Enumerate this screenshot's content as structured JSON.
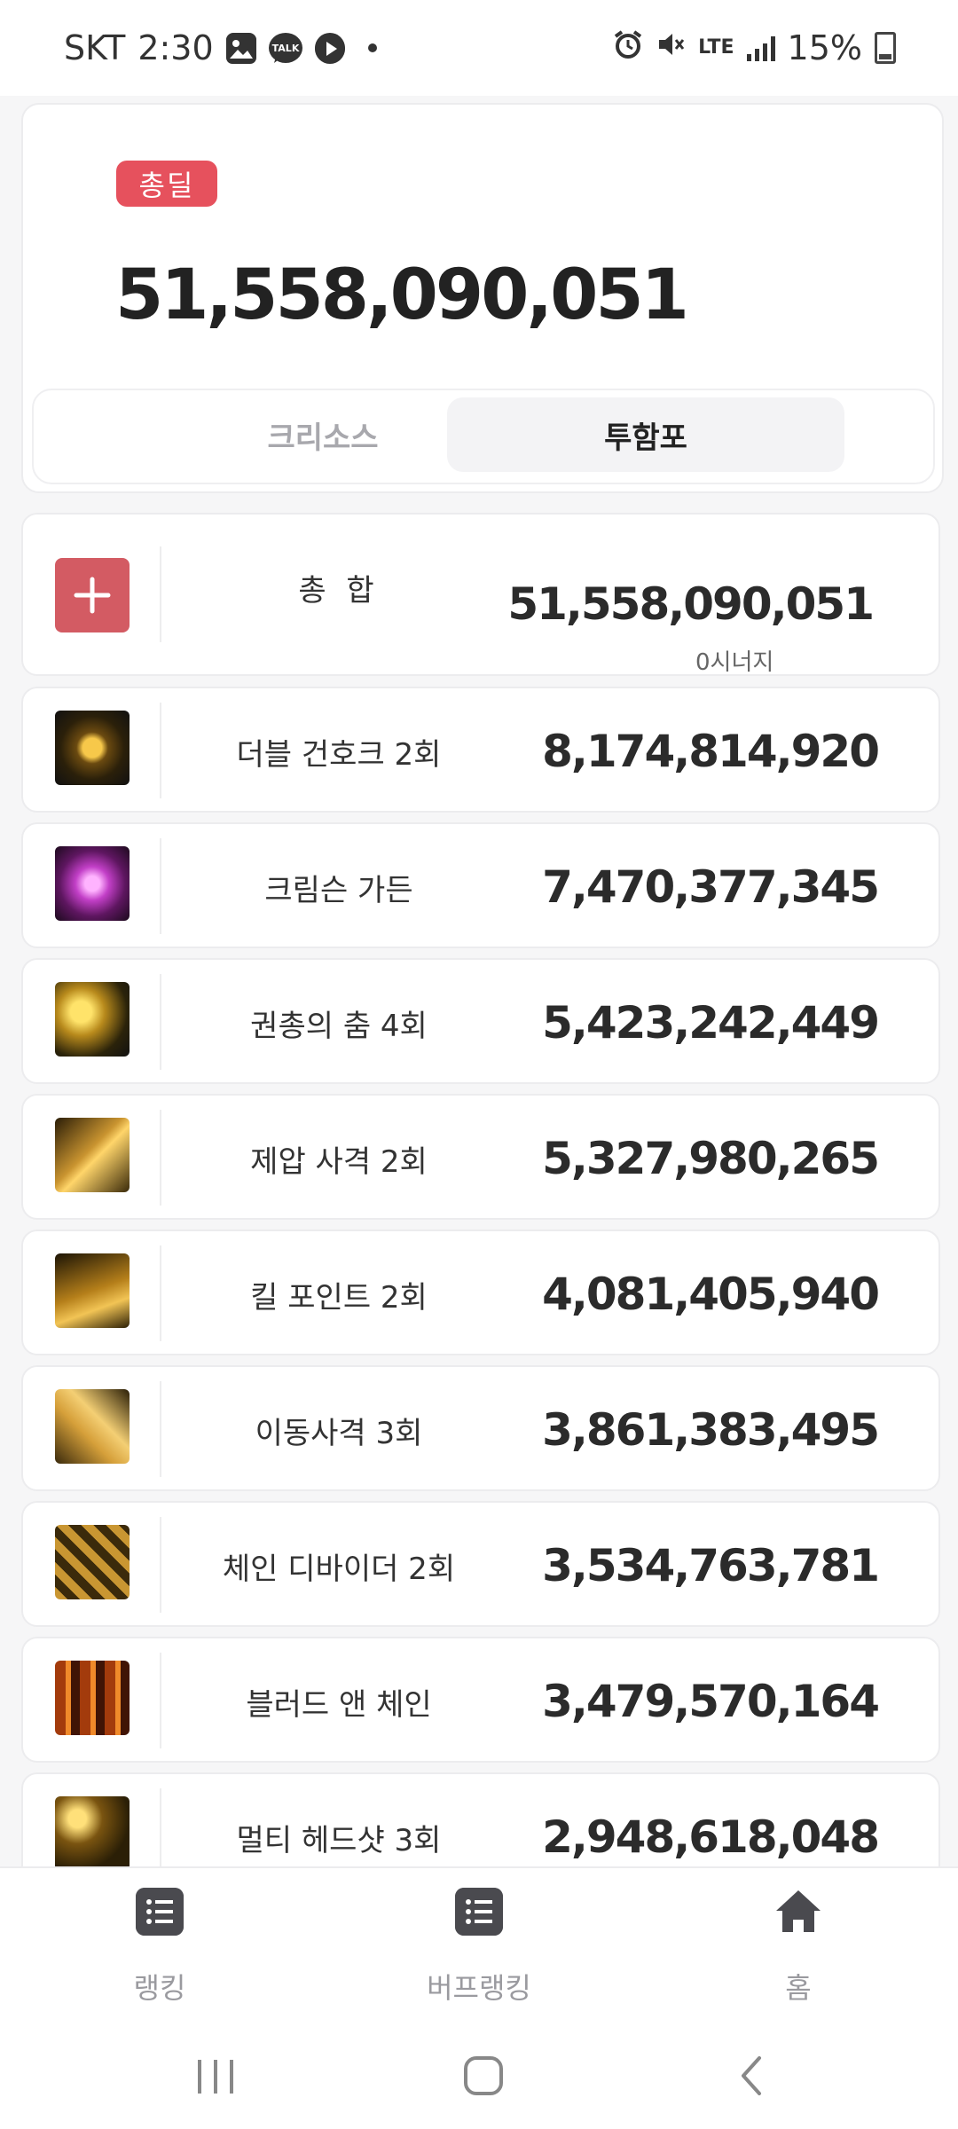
{
  "status_bar": {
    "carrier": "SKT",
    "time": "2:30",
    "left_icons": [
      "gallery-icon",
      "talk-icon",
      "play-icon",
      "dot-icon"
    ],
    "talk_text": "TALK",
    "network": "LTE",
    "battery": "15%",
    "right_icons": [
      "alarm-icon",
      "mute-icon",
      "lte-icon",
      "signal-icon",
      "battery-icon"
    ]
  },
  "summary": {
    "badge": "총딜",
    "total": "51,558,090,051",
    "tabs": [
      {
        "label": "크리소스",
        "active": false
      },
      {
        "label": "투함포",
        "active": true
      }
    ]
  },
  "total_row": {
    "label": "총 합",
    "value": "51,558,090,051",
    "synergy": "0시너지",
    "icon": "plus-icon"
  },
  "skills": [
    {
      "name": "더블 건호크 2회",
      "value": "8,174,814,920",
      "icon": "double-gunhawk-icon"
    },
    {
      "name": "크림슨 가든",
      "value": "7,470,377,345",
      "icon": "crimson-garden-icon"
    },
    {
      "name": "권총의 춤 4회",
      "value": "5,423,242,449",
      "icon": "pistol-dance-icon"
    },
    {
      "name": "제압 사격 2회",
      "value": "5,327,980,265",
      "icon": "suppressing-fire-icon"
    },
    {
      "name": "킬 포인트 2회",
      "value": "4,081,405,940",
      "icon": "kill-point-icon"
    },
    {
      "name": "이동사격 3회",
      "value": "3,861,383,495",
      "icon": "moving-shot-icon"
    },
    {
      "name": "체인 디바이더 2회",
      "value": "3,534,763,781",
      "icon": "chain-divider-icon"
    },
    {
      "name": "블러드 앤 체인",
      "value": "3,479,570,164",
      "icon": "blood-and-chain-icon"
    },
    {
      "name": "멀티 헤드샷 3회",
      "value": "2,948,618,048",
      "icon": "multi-headshot-icon"
    }
  ],
  "bottom_nav": [
    {
      "label": "랭킹",
      "icon": "list-icon"
    },
    {
      "label": "버프랭킹",
      "icon": "list-icon"
    },
    {
      "label": "홈",
      "icon": "home-icon"
    }
  ],
  "system_nav": [
    "recents-icon",
    "home-button-icon",
    "back-icon"
  ]
}
